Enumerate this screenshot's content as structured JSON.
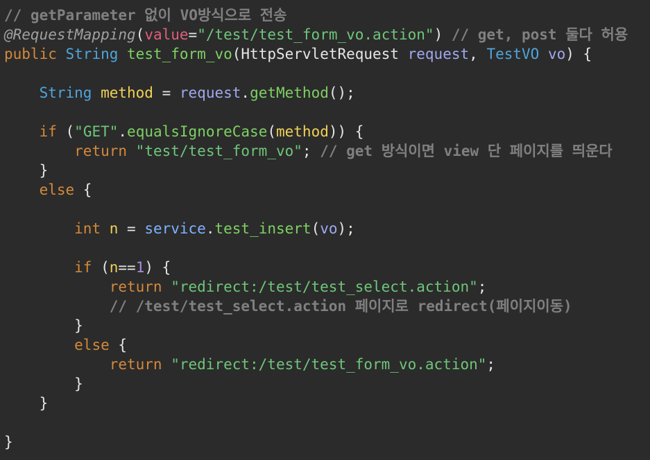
{
  "editor": {
    "background": "#2b2b2b",
    "lines": [
      [
        {
          "t": "// getParameter ",
          "k": "comment"
        },
        {
          "t": "없이 VO방식으로 전송",
          "k": "comment"
        }
      ],
      [
        {
          "t": "@RequestMapping",
          "k": "annotation"
        },
        {
          "t": "(",
          "k": "punct"
        },
        {
          "t": "value",
          "k": "attr"
        },
        {
          "t": "=",
          "k": "punct"
        },
        {
          "t": "\"/test/test_form_vo.action\"",
          "k": "string"
        },
        {
          "t": ") ",
          "k": "punct"
        },
        {
          "t": "// get, post 둘다 허용",
          "k": "comment"
        }
      ],
      [
        {
          "t": "public ",
          "k": "keyword"
        },
        {
          "t": "String ",
          "k": "type"
        },
        {
          "t": "test_form_vo",
          "k": "method"
        },
        {
          "t": "(",
          "k": "punct"
        },
        {
          "t": "HttpServletRequest ",
          "k": "plain"
        },
        {
          "t": "request",
          "k": "param"
        },
        {
          "t": ", ",
          "k": "punct"
        },
        {
          "t": "TestVO ",
          "k": "type"
        },
        {
          "t": "vo",
          "k": "param"
        },
        {
          "t": ") {",
          "k": "punct"
        }
      ],
      [],
      [
        {
          "t": "    ",
          "k": "plain"
        },
        {
          "t": "String ",
          "k": "type"
        },
        {
          "t": "method",
          "k": "var"
        },
        {
          "t": " = ",
          "k": "punct"
        },
        {
          "t": "request",
          "k": "param"
        },
        {
          "t": ".",
          "k": "punct"
        },
        {
          "t": "getMethod",
          "k": "method"
        },
        {
          "t": "();",
          "k": "punct"
        }
      ],
      [],
      [
        {
          "t": "    ",
          "k": "plain"
        },
        {
          "t": "if",
          "k": "keyword"
        },
        {
          "t": " (",
          "k": "punct"
        },
        {
          "t": "\"GET\"",
          "k": "string"
        },
        {
          "t": ".",
          "k": "punct"
        },
        {
          "t": "equalsIgnoreCase",
          "k": "method"
        },
        {
          "t": "(",
          "k": "punct"
        },
        {
          "t": "method",
          "k": "var"
        },
        {
          "t": ")) {",
          "k": "punct"
        }
      ],
      [
        {
          "t": "        ",
          "k": "plain"
        },
        {
          "t": "return ",
          "k": "keyword"
        },
        {
          "t": "\"test/test_form_vo\"",
          "k": "string"
        },
        {
          "t": "; ",
          "k": "punct"
        },
        {
          "t": "// get 방식이면 view 단 페이지를 띄운다",
          "k": "comment"
        }
      ],
      [
        {
          "t": "    }",
          "k": "punct"
        }
      ],
      [
        {
          "t": "    ",
          "k": "plain"
        },
        {
          "t": "else",
          "k": "keyword"
        },
        {
          "t": " {",
          "k": "punct"
        }
      ],
      [],
      [
        {
          "t": "        ",
          "k": "plain"
        },
        {
          "t": "int ",
          "k": "keyword"
        },
        {
          "t": "n",
          "k": "var"
        },
        {
          "t": " = ",
          "k": "punct"
        },
        {
          "t": "service",
          "k": "field"
        },
        {
          "t": ".",
          "k": "punct"
        },
        {
          "t": "test_insert",
          "k": "method"
        },
        {
          "t": "(",
          "k": "punct"
        },
        {
          "t": "vo",
          "k": "param"
        },
        {
          "t": ");",
          "k": "punct"
        }
      ],
      [],
      [
        {
          "t": "        ",
          "k": "plain"
        },
        {
          "t": "if",
          "k": "keyword"
        },
        {
          "t": " (",
          "k": "punct"
        },
        {
          "t": "n",
          "k": "var"
        },
        {
          "t": "==",
          "k": "punct"
        },
        {
          "t": "1",
          "k": "number"
        },
        {
          "t": ") {",
          "k": "punct"
        }
      ],
      [
        {
          "t": "            ",
          "k": "plain"
        },
        {
          "t": "return ",
          "k": "keyword"
        },
        {
          "t": "\"redirect:/test/test_select.action\"",
          "k": "string"
        },
        {
          "t": ";",
          "k": "punct"
        }
      ],
      [
        {
          "t": "            ",
          "k": "plain"
        },
        {
          "t": "// /test/test_select.action 페이지로 redirect(페이지이동)",
          "k": "comment"
        }
      ],
      [
        {
          "t": "        }",
          "k": "punct"
        }
      ],
      [
        {
          "t": "        ",
          "k": "plain"
        },
        {
          "t": "else",
          "k": "keyword"
        },
        {
          "t": " {",
          "k": "punct"
        }
      ],
      [
        {
          "t": "            ",
          "k": "plain"
        },
        {
          "t": "return ",
          "k": "keyword"
        },
        {
          "t": "\"redirect:/test/test_form_vo.action\"",
          "k": "string"
        },
        {
          "t": ";",
          "k": "punct"
        }
      ],
      [
        {
          "t": "        }",
          "k": "punct"
        }
      ],
      [
        {
          "t": "    }",
          "k": "punct"
        }
      ],
      [],
      [
        {
          "t": "}",
          "k": "punct"
        }
      ]
    ]
  }
}
